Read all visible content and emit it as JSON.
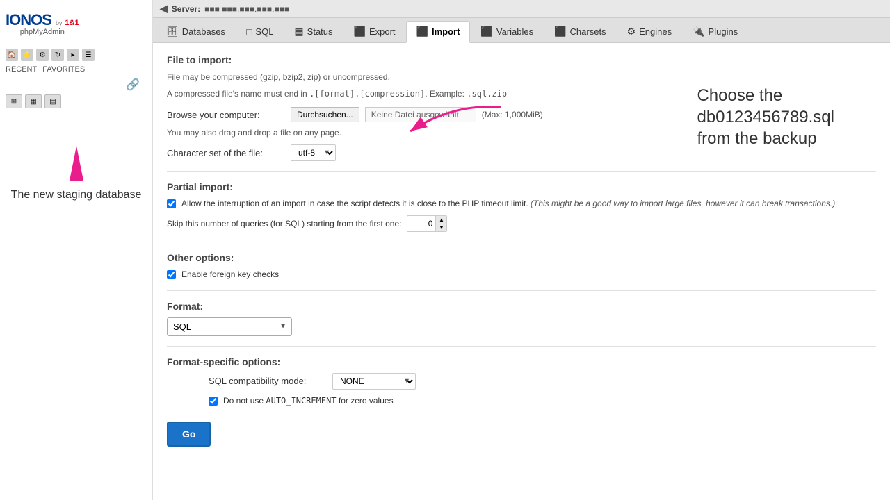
{
  "sidebar": {
    "logo": "IONOS",
    "logo_sub": "by",
    "logo_brand": "1&1",
    "phpmyadmin": "phpMyAdmin",
    "links": [
      "RECENT",
      "FAVORITES"
    ],
    "annotation_text": "The new staging database"
  },
  "topbar": {
    "server_label": "Server:",
    "server_info": "■■■ ■■■.■■■.■■■.■■■"
  },
  "nav": {
    "tabs": [
      {
        "label": "Databases",
        "icon": "🗄"
      },
      {
        "label": "SQL",
        "icon": "🔲"
      },
      {
        "label": "Status",
        "icon": "📊"
      },
      {
        "label": "Export",
        "icon": "📤"
      },
      {
        "label": "Import",
        "icon": "📥",
        "active": true
      },
      {
        "label": "Variables",
        "icon": "🔲"
      },
      {
        "label": "Charsets",
        "icon": "🔠"
      },
      {
        "label": "Engines",
        "icon": "⚙"
      },
      {
        "label": "Plugins",
        "icon": "🔌"
      }
    ]
  },
  "content": {
    "file_to_import": {
      "section_title": "File to import:",
      "desc1": "File may be compressed (gzip, bzip2, zip) or uncompressed.",
      "desc2": "A compressed file's name must end in .[format].[compression]. Example: .sql.zip",
      "browse_label": "Browse your computer:",
      "browse_btn": "Durchsuchen...",
      "file_placeholder": "Keine Datei ausgewählt.",
      "max_label": "(Max: 1,000MiB)",
      "drag_note": "You may also drag and drop a file on any page.",
      "charset_label": "Character set of the file:",
      "charset_value": "utf-8"
    },
    "partial_import": {
      "section_title": "Partial import:",
      "checkbox1_checked": true,
      "checkbox1_label": "Allow the interruption of an import in case the script detects it is close to the PHP timeout limit.",
      "checkbox1_note": "(This might be a good way to import large files, however it can break transactions.)",
      "skip_label": "Skip this number of queries (for SQL) starting from the first one:",
      "skip_value": "0"
    },
    "other_options": {
      "section_title": "Other options:",
      "foreign_key_checked": true,
      "foreign_key_label": "Enable foreign key checks"
    },
    "format": {
      "section_title": "Format:",
      "value": "SQL"
    },
    "format_specific": {
      "section_title": "Format-specific options:",
      "compat_label": "SQL compatibility mode:",
      "compat_value": "NONE",
      "auto_increment_checked": true,
      "auto_increment_label": "Do not use AUTO_INCREMENT for zero values"
    },
    "go_btn": "Go"
  },
  "annotation": {
    "callout": "Choose the\ndb0123456789.sql\nfrom the backup"
  }
}
